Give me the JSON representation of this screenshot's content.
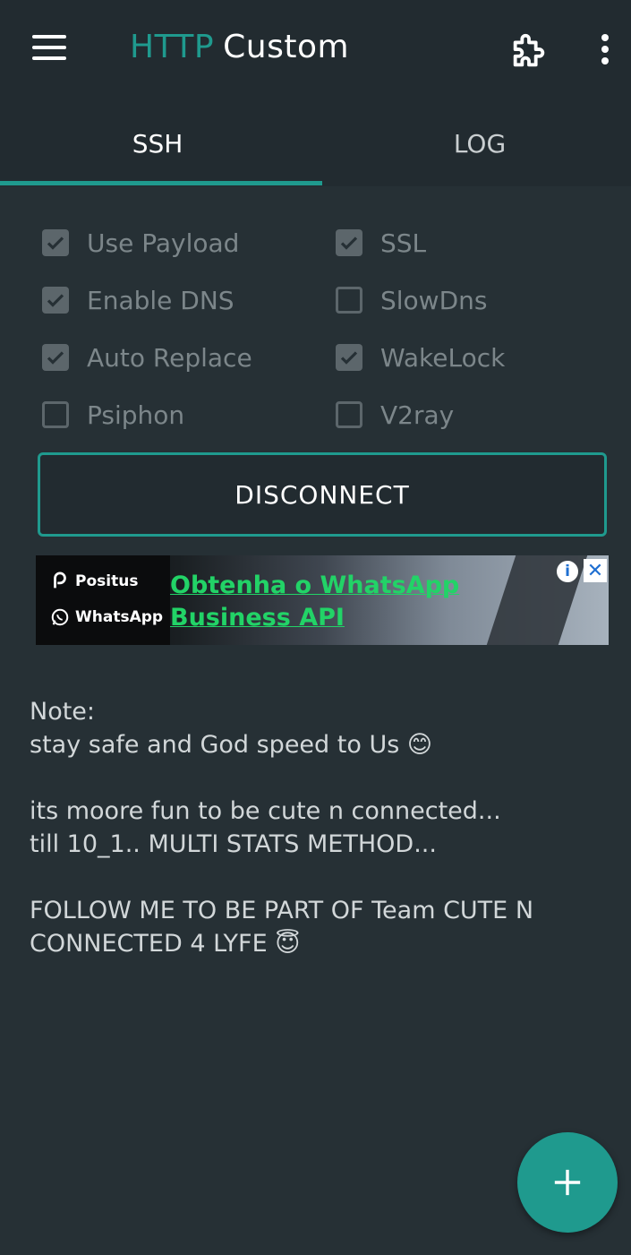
{
  "appbar": {
    "title_accent": "HTTP",
    "title_rest": "Custom",
    "menu_icon": "menu-icon",
    "extension_icon": "puzzle-icon",
    "more_icon": "more-vert-icon"
  },
  "tabs": [
    {
      "label": "SSH",
      "selected": true
    },
    {
      "label": "LOG",
      "selected": false
    }
  ],
  "options": {
    "use_payload": {
      "label": "Use Payload",
      "checked": true
    },
    "ssl": {
      "label": "SSL",
      "checked": true
    },
    "enable_dns": {
      "label": "Enable DNS",
      "checked": true
    },
    "slowdns": {
      "label": "SlowDns",
      "checked": false
    },
    "auto_replace": {
      "label": "Auto Replace",
      "checked": true
    },
    "wakelock": {
      "label": "WakeLock",
      "checked": true
    },
    "psiphon": {
      "label": "Psiphon",
      "checked": false
    },
    "v2ray": {
      "label": "V2ray",
      "checked": false
    }
  },
  "connect_button": {
    "label": "DISCONNECT"
  },
  "ad": {
    "brand_1": "Positus",
    "brand_2": "WhatsApp",
    "headline_1": "Obtenha o WhatsApp",
    "headline_2": "Business API",
    "info_glyph": "i",
    "close_glyph": "✕"
  },
  "note": {
    "lines": [
      "Note:",
      "stay safe and God speed to Us 😊",
      "",
      "its moore fun to be cute n connected...",
      "till 10_1.. MULTI STATS METHOD...",
      "",
      "FOLLOW ME TO BE PART OF Team CUTE N",
      "CONNECTED 4 LYFE 😇"
    ]
  },
  "fab": {
    "icon": "plus-icon"
  },
  "colors": {
    "accent": "#1f9a8e",
    "background": "#263035",
    "toolbar": "#222b30",
    "ad_headline": "#22d367"
  }
}
